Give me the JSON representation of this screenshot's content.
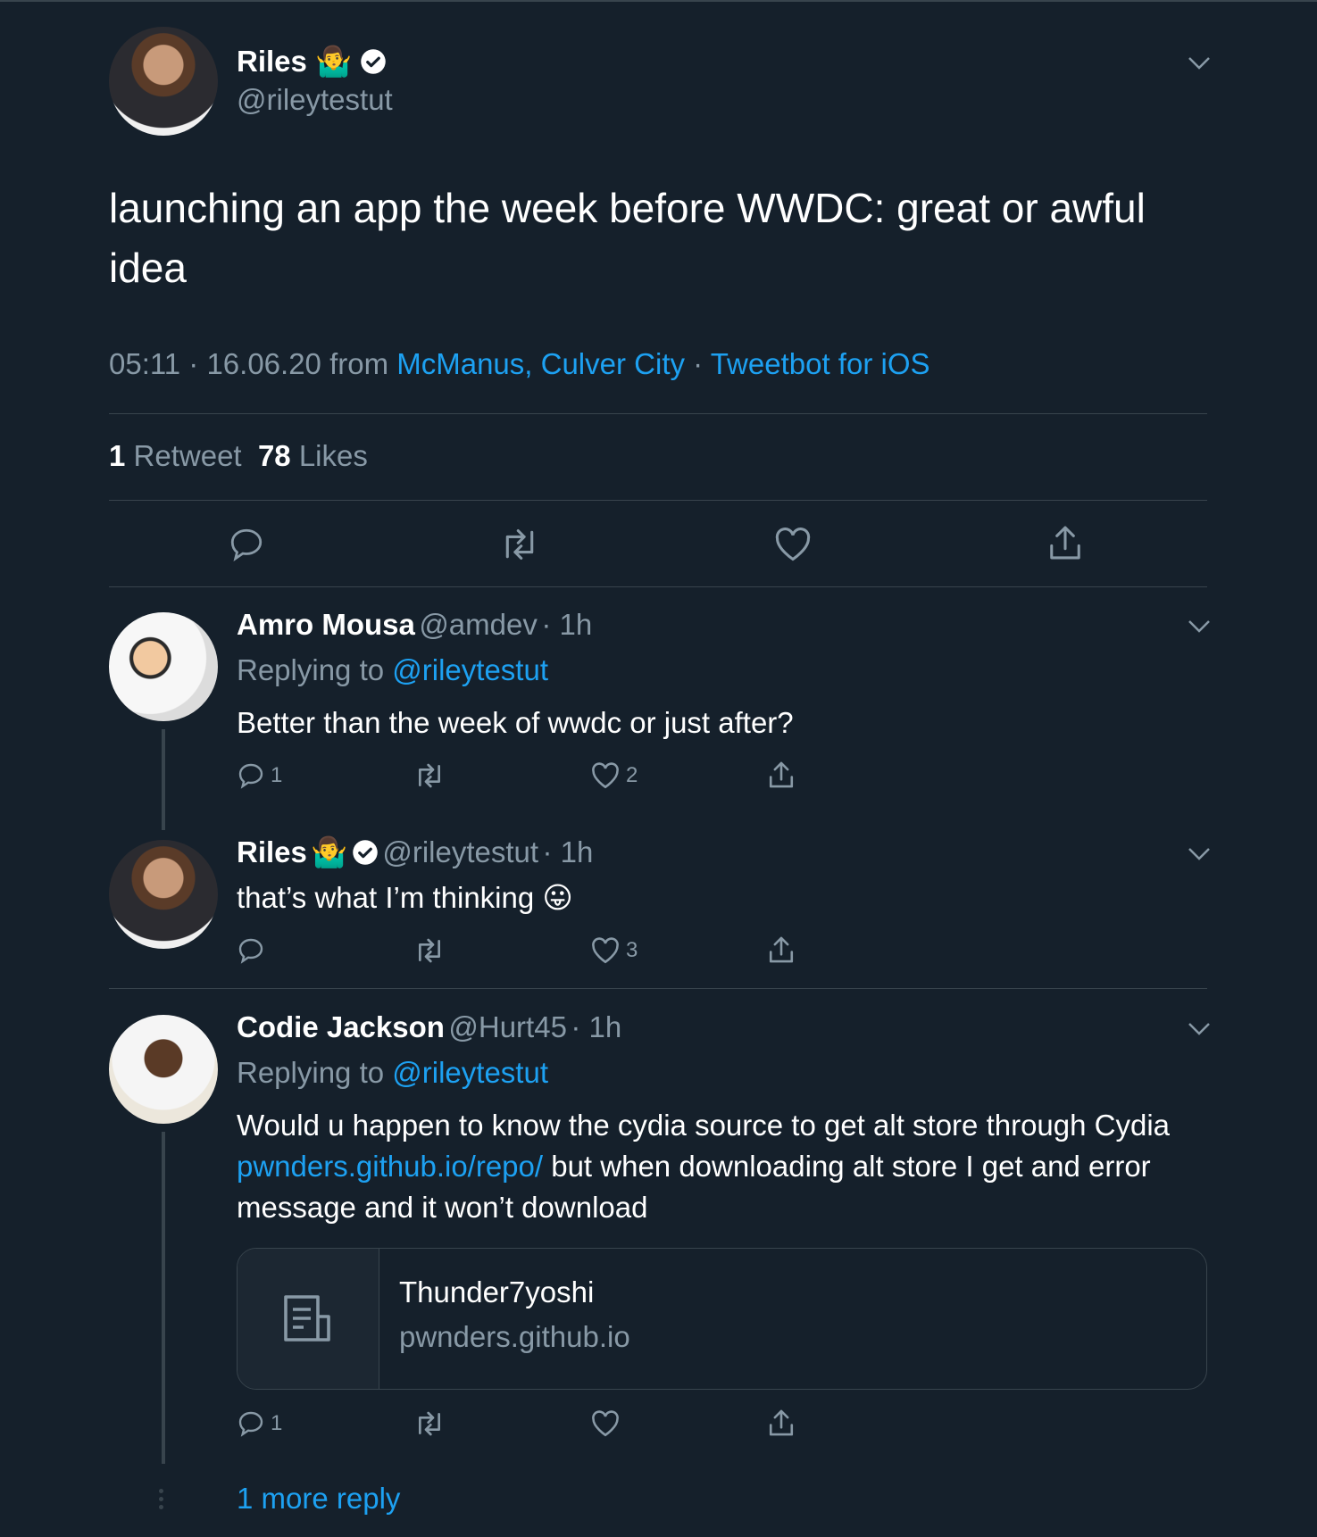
{
  "main_tweet": {
    "name": "Riles",
    "emoji": "🤷‍♂️",
    "handle": "@rileytestut",
    "text": "launching an app the week before WWDC: great or awful idea",
    "time_date": "05:11 · 16.06.20 from ",
    "location": "McManus, Culver City",
    "sep": " · ",
    "client": "Tweetbot for iOS",
    "retweet_count": "1",
    "retweet_label": "Retweet",
    "like_count": "78",
    "like_label": "Likes"
  },
  "replies": [
    {
      "name": "Amro Mousa",
      "handle": "@amdev",
      "time": "· 1h",
      "replying_label": "Replying to ",
      "replying_to": "@rileytestut",
      "text": "Better than the week of wwdc or just after?",
      "reply_count": "1",
      "like_count": "2"
    },
    {
      "name": "Riles",
      "emoji": "🤷‍♂️",
      "handle": "@rileytestut",
      "time": "· 1h",
      "text": "that’s what I’m thinking 😛",
      "like_count": "3"
    },
    {
      "name": "Codie Jackson",
      "handle": "@Hurt45",
      "time": "· 1h",
      "replying_label": "Replying to ",
      "replying_to": "@rileytestut",
      "text_before": "Would u happen to know the cydia source to get alt store through Cydia ",
      "link": "pwnders.github.io/repo/",
      "text_after": " but when downloading alt store I get and error message and it won’t download",
      "card_title": "Thunder7yoshi",
      "card_domain": "pwnders.github.io",
      "reply_count": "1"
    }
  ],
  "more_replies": "1 more reply",
  "colors": {
    "background": "#15202b",
    "accent": "#1da1f2",
    "muted": "#8899a6",
    "divider": "#38444d"
  },
  "icons": [
    "chevron-down-icon",
    "verified-icon",
    "reply-icon",
    "retweet-icon",
    "like-icon",
    "share-icon",
    "document-icon"
  ]
}
